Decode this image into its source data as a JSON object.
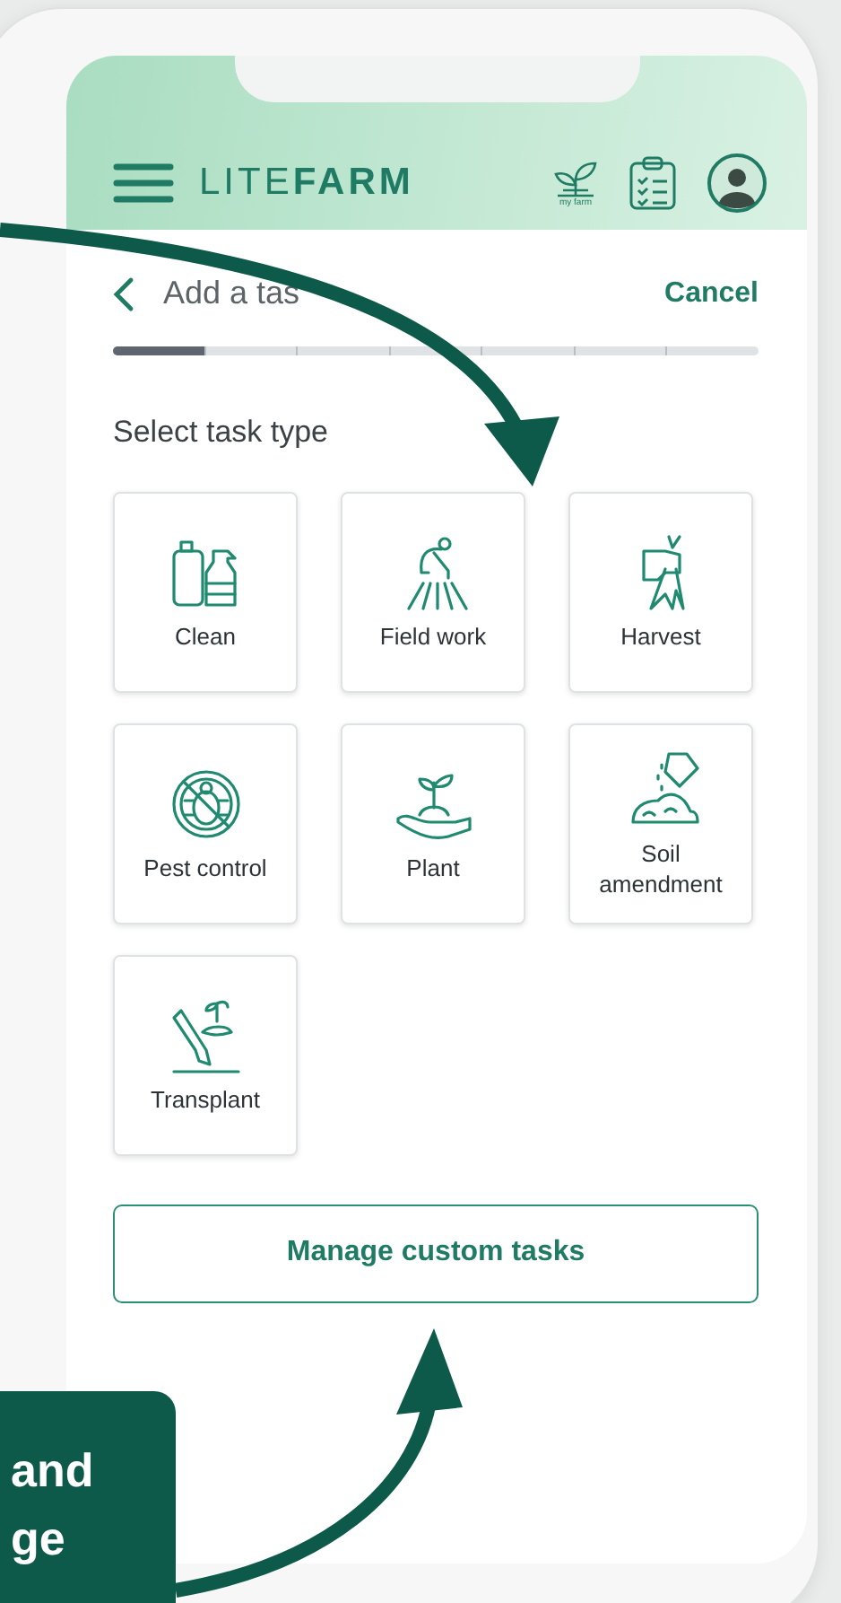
{
  "header": {
    "logo": "LITE**FARM**",
    "farm_label": "my farm"
  },
  "nav": {
    "title": "Add a tas",
    "cancel": "Cancel"
  },
  "progress": {
    "level": 0.143
  },
  "prompt": "Select task type",
  "task_types": [
    {
      "label": "Clean"
    },
    {
      "label": "Field work"
    },
    {
      "label": "Harvest"
    },
    {
      "label": "Pest control"
    },
    {
      "label": "Plant"
    },
    {
      "label": "Soil amendment"
    },
    {
      "label": "Transplant"
    }
  ],
  "button": "Manage custom tasks",
  "callout": [
    "and",
    "ge"
  ]
}
